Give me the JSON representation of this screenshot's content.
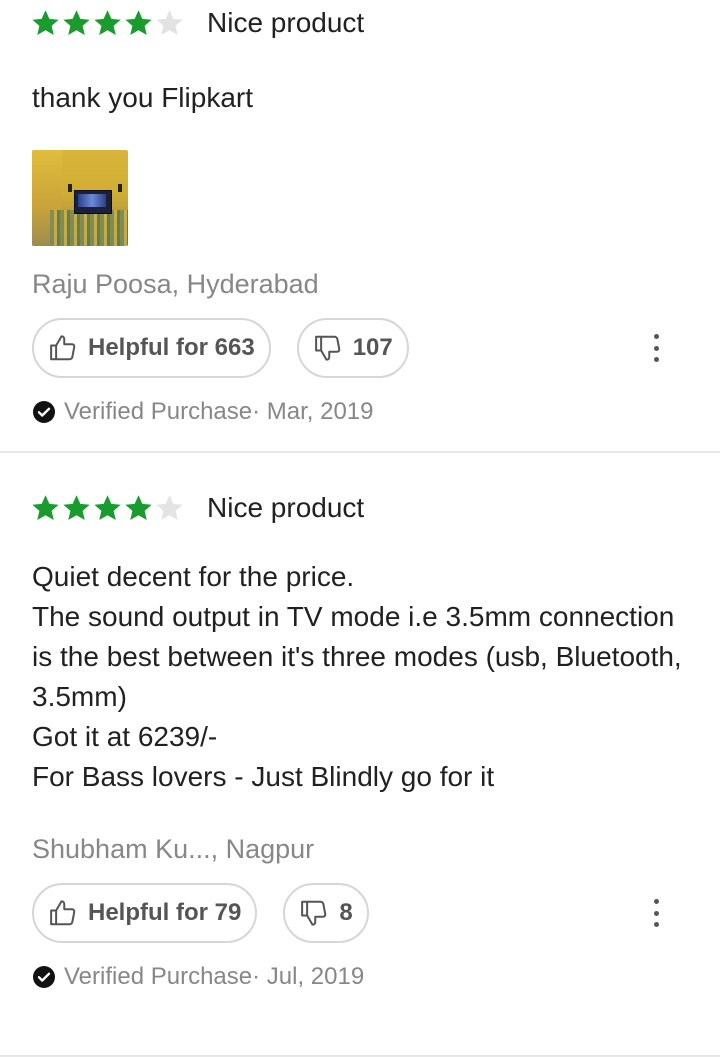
{
  "colors": {
    "star_filled": "#14958f",
    "star_green": "#1a9b2e",
    "star_empty": "#e0e0e0",
    "meta_gray": "#878787",
    "border_gray": "#d6d6d6"
  },
  "reviews": [
    {
      "rating": 4,
      "rating_max": 5,
      "title": "Nice product",
      "body": "thank you Flipkart",
      "has_image": true,
      "image_icon": "review-photo",
      "reviewer": "Raju Poosa, Hyderabad",
      "helpful_label": "Helpful for 663",
      "dislike_count": "107",
      "verified_text": "Verified Purchase· Mar, 2019"
    },
    {
      "rating": 4,
      "rating_max": 5,
      "title": "Nice product",
      "body": "Quiet decent for the price.\nThe sound output in TV mode i.e 3.5mm connection is the best between it's three modes (usb, Bluetooth, 3.5mm)\nGot it at 6239/-\nFor Bass lovers - Just Blindly go for it",
      "has_image": false,
      "reviewer": "Shubham Ku..., Nagpur",
      "helpful_label": "Helpful for 79",
      "dislike_count": "8",
      "verified_text": "Verified Purchase· Jul, 2019"
    }
  ],
  "icons": {
    "like": "thumbs-up-icon",
    "dislike": "thumbs-down-icon",
    "more": "more-vertical-icon",
    "verified": "check-circle-icon",
    "star": "star-icon"
  }
}
